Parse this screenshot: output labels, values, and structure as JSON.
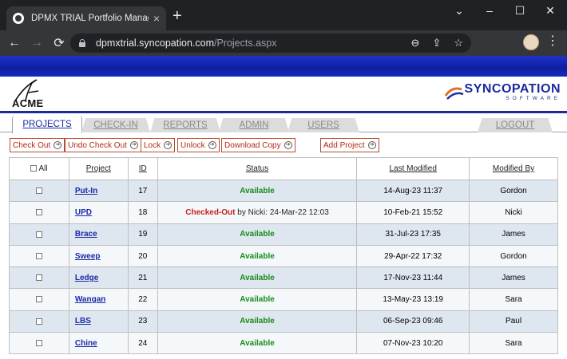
{
  "browser": {
    "tab_title": "DPMX TRIAL Portfolio Managem",
    "tab_close": "×",
    "new_tab": "+",
    "url_host": "dpmxtrial.syncopation.com",
    "url_path": "/Projects.aspx",
    "controls": {
      "minimize": "–",
      "maximize": "☐",
      "close": "✕",
      "dropdown": "⌄"
    },
    "nav": {
      "back": "←",
      "forward": "→",
      "reload": "⟳"
    },
    "omni_icons": {
      "zoom": "⊖",
      "share": "⇪",
      "bookmark": "☆"
    },
    "menu": "⋮"
  },
  "header": {
    "company": "ACME",
    "vendor_name": "SYNCOPATION",
    "vendor_sub": "SOFTWARE"
  },
  "tabs": [
    {
      "label": "PROJECTS",
      "active": true
    },
    {
      "label": "CHECK-IN",
      "active": false
    },
    {
      "label": "REPORTS",
      "active": false
    },
    {
      "label": "ADMIN",
      "active": false
    },
    {
      "label": "USERS",
      "active": false
    },
    {
      "label": "LOGOUT",
      "active": false
    }
  ],
  "actions": {
    "check_out": "Check Out",
    "undo_check_out": "Undo Check Out",
    "lock": "Lock",
    "unlock": "Unlock",
    "download_copy": "Download Copy",
    "add_project": "Add Project"
  },
  "table": {
    "headers": {
      "all": "All",
      "project": "Project",
      "id": "ID",
      "status": "Status",
      "last_modified": "Last Modified",
      "modified_by": "Modified By"
    },
    "rows": [
      {
        "project": "Put-In",
        "id": "17",
        "status": "Available",
        "last_modified": "14-Aug-23 11:37",
        "modified_by": "Gordon"
      },
      {
        "project": "UPD",
        "id": "18",
        "status": "Checked-Out",
        "status_rest": " by Nicki: 24-Mar-22 12:03",
        "last_modified": "10-Feb-21 15:52",
        "modified_by": "Nicki"
      },
      {
        "project": "Brace",
        "id": "19",
        "status": "Available",
        "last_modified": "31-Jul-23 17:35",
        "modified_by": "James"
      },
      {
        "project": "Sweep",
        "id": "20",
        "status": "Available",
        "last_modified": "29-Apr-22 17:32",
        "modified_by": "Gordon"
      },
      {
        "project": "Ledge",
        "id": "21",
        "status": "Available",
        "last_modified": "17-Nov-23 11:44",
        "modified_by": "James"
      },
      {
        "project": "Wangan",
        "id": "22",
        "status": "Available",
        "last_modified": "13-May-23 13:19",
        "modified_by": "Sara"
      },
      {
        "project": "LBS",
        "id": "23",
        "status": "Available",
        "last_modified": "06-Sep-23 09:46",
        "modified_by": "Paul"
      },
      {
        "project": "Chine",
        "id": "24",
        "status": "Available",
        "last_modified": "07-Nov-23 10:20",
        "modified_by": "Sara"
      }
    ]
  },
  "colors": {
    "brand_blue": "#1b2a9e",
    "available": "#1a8d1a",
    "checked_out": "#c81e1e"
  }
}
